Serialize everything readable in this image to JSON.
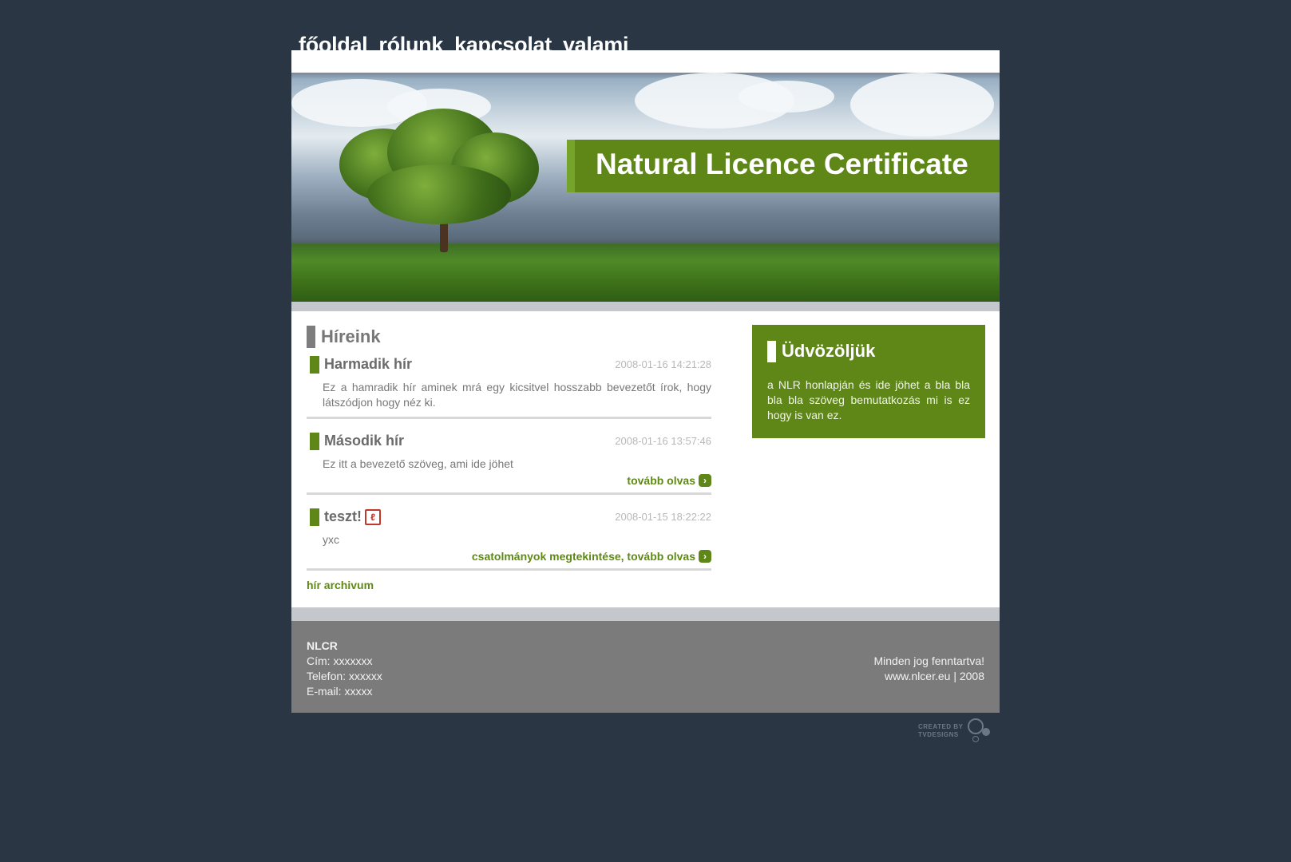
{
  "nav": {
    "items": [
      {
        "label": "főoldal"
      },
      {
        "label": "rólunk"
      },
      {
        "label": "kapcsolat"
      },
      {
        "label": "valami"
      }
    ]
  },
  "banner": {
    "title": "Natural Licence Certificate"
  },
  "news": {
    "section_title": "Híreink",
    "items": [
      {
        "title": "Harmadik hír",
        "date": "2008-01-16 14:21:28",
        "body": "Ez a hamradik hír aminek mrá egy kicsitvel hosszabb bevezetőt írok, hogy látszódjon hogy néz ki."
      },
      {
        "title": "Második hír",
        "date": "2008-01-16 13:57:46",
        "body": "Ez itt a bevezető szöveg, ami ide jöhet",
        "more": "tovább olvas"
      },
      {
        "title": "teszt!",
        "date": "2008-01-15 18:22:22",
        "body": "yxc",
        "more": "csatolmányok megtekintése, tovább olvas"
      }
    ],
    "archive_link": "hír archivum"
  },
  "welcome": {
    "title": "Üdvözöljük",
    "body": "a NLR honlapján és ide jöhet a bla bla bla bla szöveg bemutatkozás mi is ez hogy is van ez."
  },
  "footer": {
    "org": "NLCR",
    "address": "Cím: xxxxxxx",
    "phone": "Telefon: xxxxxx",
    "email": "E-mail: xxxxx",
    "rights": "Minden jog fenntartva!",
    "site": "www.nlcer.eu | 2008"
  },
  "credit": {
    "line1": "CREATED BY",
    "line2": "TVDESIGNS"
  },
  "colors": {
    "background": "#2a3644",
    "accent_green": "#5e8718",
    "link_green": "#5e8a14",
    "footer_grey": "#7b7b7b"
  },
  "icons": [
    "arrow-right-icon",
    "pdf-icon"
  ]
}
